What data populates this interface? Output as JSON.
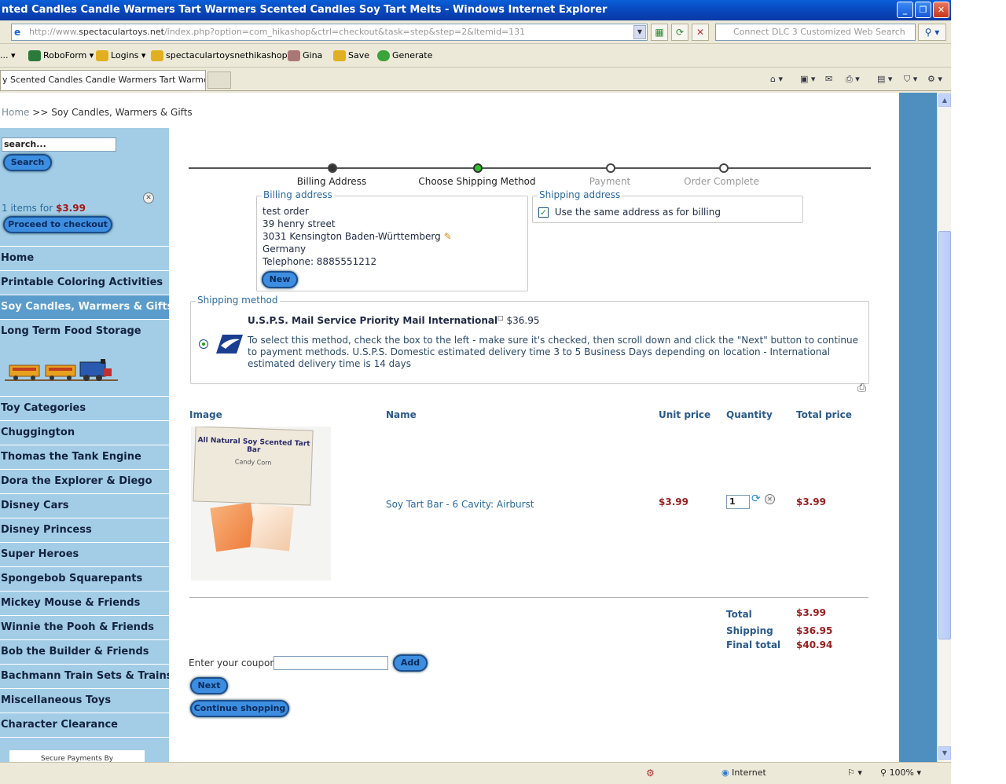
{
  "window": {
    "title": "nted Candles Candle Warmers Tart Warmers Scented Candles Soy Tart Melts - Windows Internet Explorer"
  },
  "address_bar": {
    "url_prefix": "http://www.",
    "url_domain": "spectaculartoys.net",
    "url_path": "/index.php?option=com_hikashop&ctrl=checkout&task=step&step=2&Itemid=131",
    "search_placeholder": "Connect DLC 3 Customized Web Search"
  },
  "links_bar": {
    "items": [
      "RoboForm",
      "Logins",
      "spectaculartoysnethikashop",
      "Gina",
      "Save",
      "Generate"
    ]
  },
  "tab": {
    "label": "y Scented Candles Candle Warmers Tart Warmers ..."
  },
  "breadcrumb": {
    "home": "Home",
    "separator": ">>",
    "current": "Soy Candles, Warmers & Gifts"
  },
  "sidebar": {
    "search_value": "search...",
    "search_button": "Search",
    "cart_count_text": "1 items for",
    "cart_total": "$3.99",
    "checkout_button": "Proceed to checkout",
    "menu_top": [
      "Home",
      "Printable Coloring Activities",
      "Soy Candles, Warmers & Gifts",
      "Long Term Food Storage"
    ],
    "active_item": "Soy Candles, Warmers & Gifts",
    "menu_bottom": [
      "Toy Categories",
      "Chuggington",
      "Thomas the Tank Engine",
      "Dora the Explorer & Diego",
      "Disney Cars",
      "Disney Princess",
      "Super Heroes",
      "Spongebob Squarepants",
      "Mickey Mouse & Friends",
      "Winnie the Pooh & Friends",
      "Bob the Builder & Friends",
      "Bachmann Train Sets & Trains",
      "Miscellaneous Toys",
      "Character Clearance"
    ],
    "secure_text": "Secure Payments By"
  },
  "steps": [
    "Billing Address",
    "Choose Shipping Method",
    "Payment",
    "Order Complete"
  ],
  "billing": {
    "legend": "Billing address",
    "lines": [
      "test order",
      "39 henry street",
      "3031 Kensington Baden-Württemberg",
      "Germany",
      "Telephone: 8885551212"
    ],
    "new_button": "New"
  },
  "shipping_address": {
    "legend": "Shipping address",
    "same_label": "Use the same address as for billing",
    "checked": true
  },
  "shipping_method": {
    "legend": "Shipping method",
    "name": "U.S.P.S. Mail Service Priority Mail International",
    "price": "$36.95",
    "description": "To select this method, check the box to the left - make sure it's checked, then scroll down and click the \"Next\" button to continue to payment methods. U.S.P.S. Domestic estimated delivery time 3 to 5 Business Days depending on location - International estimated delivery time is 14 days"
  },
  "cart_table": {
    "headers": [
      "Image",
      "Name",
      "Unit price",
      "Quantity",
      "Total price"
    ],
    "rows": [
      {
        "name": "Soy Tart Bar - 6 Cavity: Airburst",
        "unit_price": "$3.99",
        "quantity": "1",
        "total": "$3.99",
        "image_text": "All Natural Soy Scented Tart Bar",
        "image_subtext": "Candy Corn"
      }
    ]
  },
  "totals": {
    "total_label": "Total",
    "total": "$3.99",
    "shipping_label": "Shipping",
    "shipping": "$36.95",
    "final_label": "Final total",
    "final": "$40.94"
  },
  "coupon": {
    "label": "Enter your coupon",
    "value": "",
    "add_button": "Add"
  },
  "actions": {
    "next": "Next",
    "continue": "Continue shopping"
  },
  "status_bar": {
    "zone": "Internet",
    "zoom": "100%"
  },
  "colors": {
    "sidebar_bg": "#a3cde6",
    "active_menu": "#5a9ccb",
    "price_red": "#9c1d1d",
    "link_blue": "#2a6a9e",
    "button_blue": "#3d8ee0"
  }
}
